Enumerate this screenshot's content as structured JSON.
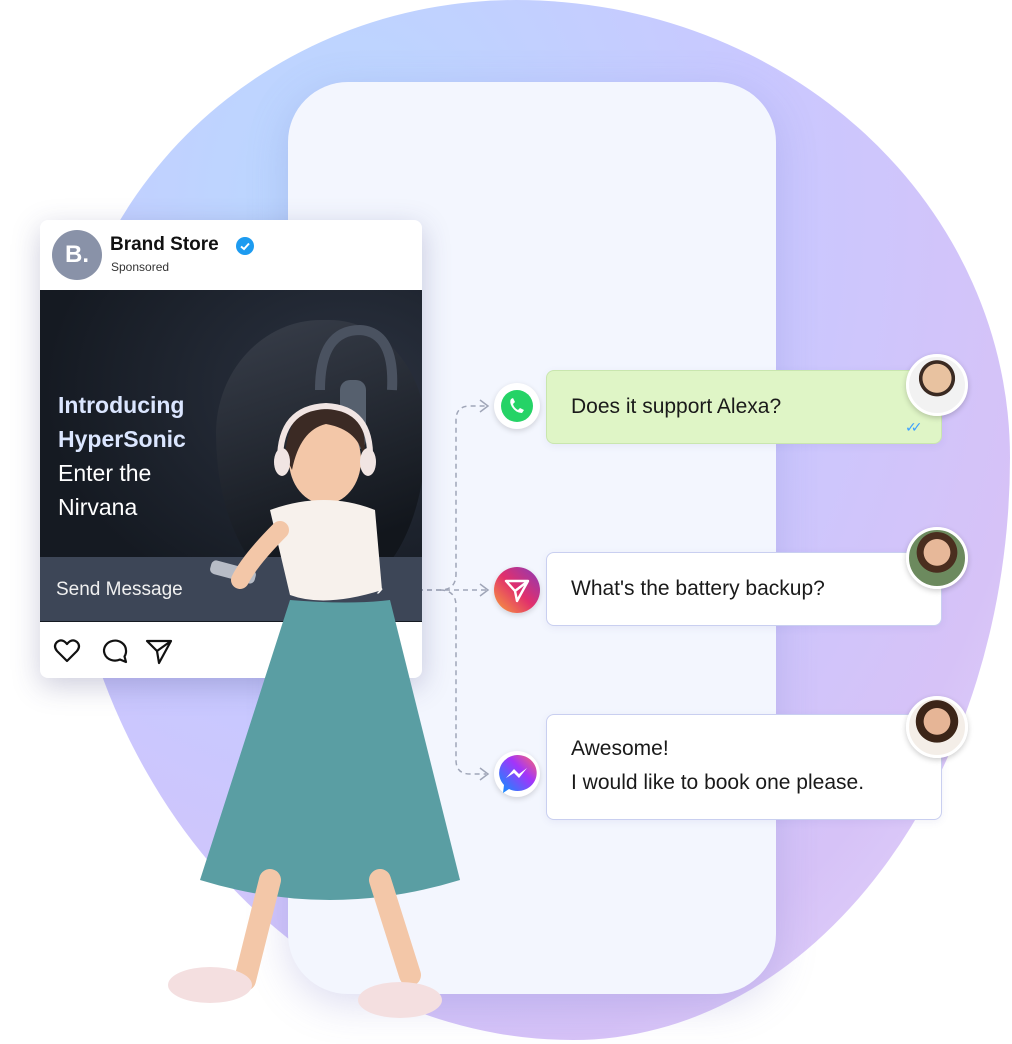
{
  "ad": {
    "avatar_letter": "B.",
    "brand_name": "Brand Store",
    "sponsored_label": "Sponsored",
    "headline_line1": "Introducing",
    "headline_line2": "HyperSonic",
    "headline_line3": "Enter the",
    "headline_line4": "Nirvana",
    "cta_label": "Send Message",
    "cta_chevron": "›",
    "actions": [
      "heart-icon",
      "comment-icon",
      "share-icon"
    ]
  },
  "chats": [
    {
      "channel": "whatsapp-icon",
      "message": "Does it support Alexa?",
      "read_ticks": "✓✓"
    },
    {
      "channel": "instagram-direct-icon",
      "message": "What's the battery backup?"
    },
    {
      "channel": "messenger-icon",
      "message_line1": "Awesome!",
      "message_line2": "I would like to book one please."
    }
  ],
  "colors": {
    "whatsapp": "#25d366",
    "instagram_start": "#f9a13a",
    "instagram_end": "#8a3ab9",
    "messenger_start": "#0695ff",
    "messenger_end": "#ff6968",
    "verified": "#1d9bf0",
    "bubble_green": "#dff5c6"
  }
}
